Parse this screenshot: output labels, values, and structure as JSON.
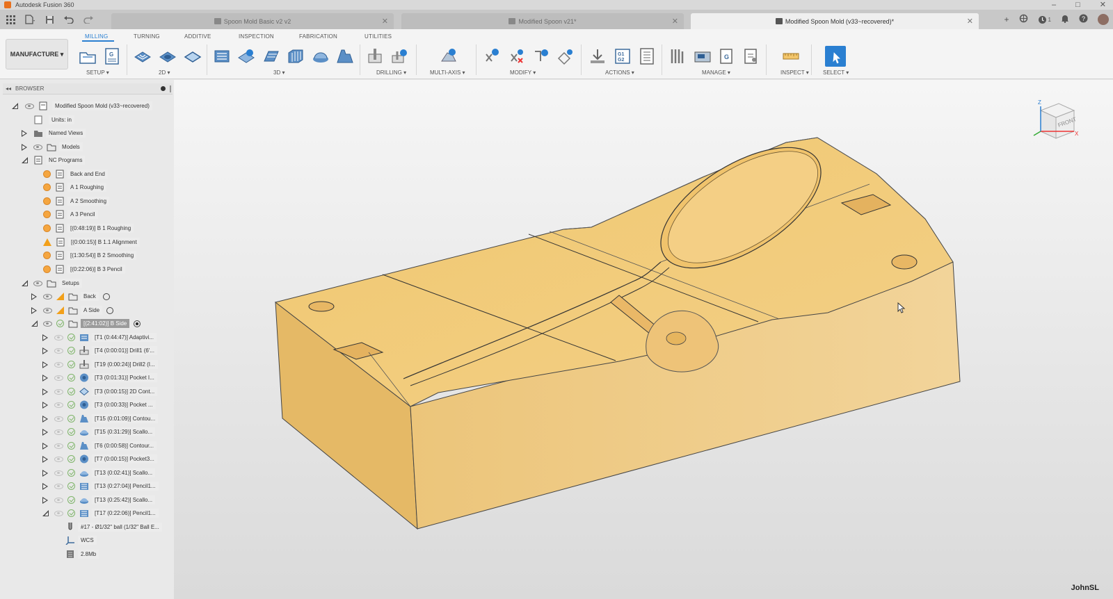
{
  "window": {
    "title": "Autodesk Fusion 360",
    "minimize": "–",
    "maximize": "□",
    "close": "✕"
  },
  "doc_tabs": [
    {
      "label": "Spoon Mold Basic v2 v2",
      "close": "✕"
    },
    {
      "label": "Modified Spoon v21*",
      "close": "✕"
    },
    {
      "label": "Modified Spoon Mold (v33~recovered)*",
      "close": "✕"
    }
  ],
  "tab_right": {
    "add": "+",
    "jobs": "1"
  },
  "workspace": {
    "label": "MANUFACTURE ▾"
  },
  "ribbon_tabs": [
    "MILLING",
    "TURNING",
    "ADDITIVE",
    "INSPECTION",
    "FABRICATION",
    "UTILITIES"
  ],
  "groups": {
    "setup": "SETUP ▾",
    "twod": "2D ▾",
    "threed": "3D ▾",
    "drilling": "DRILLING ▾",
    "multiaxis": "MULTI-AXIS ▾",
    "modify": "MODIFY ▾",
    "actions": "ACTIONS ▾",
    "manage": "MANAGE ▾",
    "inspect": "INSPECT ▾",
    "select": "SELECT ▾"
  },
  "g1g2_icon_text": "G1 G2",
  "browser": {
    "title": "BROWSER",
    "collapse": "◂◂",
    "root": "Modified Spoon Mold (v33~recovered)",
    "units": "Units: in",
    "named_views": "Named Views",
    "models": "Models",
    "nc_programs": "NC Programs",
    "nc_items": [
      "Back and End",
      "A 1 Roughing",
      "A 2 Smoothing",
      "A 3 Pencil",
      "[(0:48:19)] B 1 Roughing",
      "[(0:00:15)] B 1.1 Alignment",
      "[(1:30:54)] B 2 Smoothing",
      "[(0:22:06)] B 3 Pencil"
    ],
    "setups": "Setups",
    "setup_items": [
      "Back",
      "A Side",
      "[(2:41:02)] B Side"
    ],
    "operations": [
      "[T1 (0:44:47)] Adaptivi...",
      "[T4 (0:00:01)] Drill1 (6'...",
      "[T19 (0:00:24)] Drill2 (I...",
      "[T3 (0:01:31)] Pocket I...",
      "[T3 (0:00:15)] 2D Cont...",
      "[T3 (0:00:33)] Pocket ...",
      "[T15 (0:01:09)] Contou...",
      "[T15 (0:31:29)] Scallo...",
      "[T6 (0:00:58)] Contour...",
      "[T7 (0:00:15)] Pocket3...",
      "[T13 (0:02:41)] Scallo...",
      "[T13 (0:27:04)] Pencil1...",
      "[T13 (0:25:42)] Scallo...",
      "[T17 (0:22:06)] Pencil1..."
    ],
    "tool_item": "#17 - Ø1/32\" ball (1/32\" Ball E...",
    "wcs": "WCS",
    "size": "2.8Mb"
  },
  "viewcube": {
    "face": "FRONT",
    "axis_z": "Z",
    "axis_x": "X"
  },
  "watermark": "JohnSL",
  "colors": {
    "accent": "#2a7fd1",
    "model": "#efc572",
    "select_btn": "#2a7fd1"
  }
}
